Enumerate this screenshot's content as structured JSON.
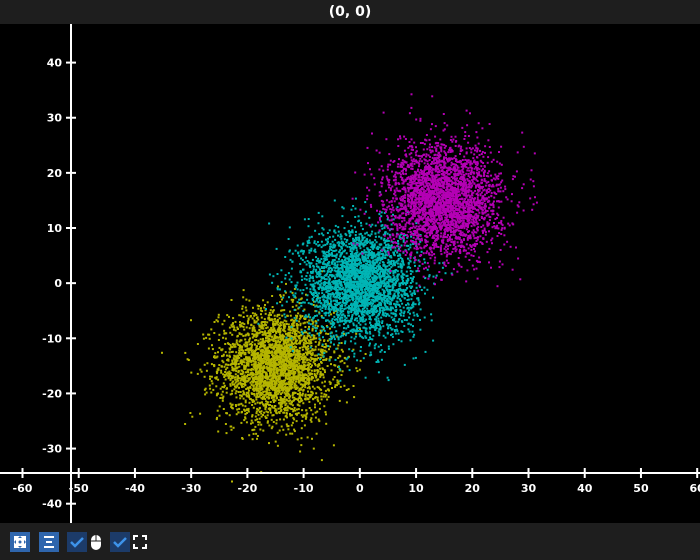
{
  "title": "(0, 0)",
  "toolbar": {
    "buttons": [
      {
        "icon": "fit-view-icon"
      },
      {
        "icon": "align-icon"
      },
      {
        "icon": "checkbox-checked-icon"
      },
      {
        "icon": "mouse-icon"
      },
      {
        "icon": "checkbox-checked-icon"
      },
      {
        "icon": "fullscreen-icon"
      }
    ]
  },
  "chart_data": {
    "type": "scatter",
    "xlim": [
      -64,
      60.5
    ],
    "ylim": [
      -43.5,
      47
    ],
    "x_ticks": [
      -60,
      -50,
      -40,
      -30,
      -20,
      -10,
      0,
      10,
      20,
      30,
      40,
      50,
      60
    ],
    "y_ticks": [
      -40,
      -30,
      -20,
      -10,
      0,
      10,
      20,
      30,
      40
    ],
    "grid": false,
    "series": [
      {
        "color": "#b5b500",
        "center": [
          -15,
          -15
        ],
        "std": [
          5,
          5
        ],
        "count": 3000
      },
      {
        "color": "#00b5b5",
        "center": [
          0,
          0
        ],
        "std": [
          5,
          5
        ],
        "count": 3000
      },
      {
        "color": "#b500b5",
        "center": [
          15,
          15
        ],
        "std": [
          5,
          5
        ],
        "count": 3000
      }
    ]
  }
}
